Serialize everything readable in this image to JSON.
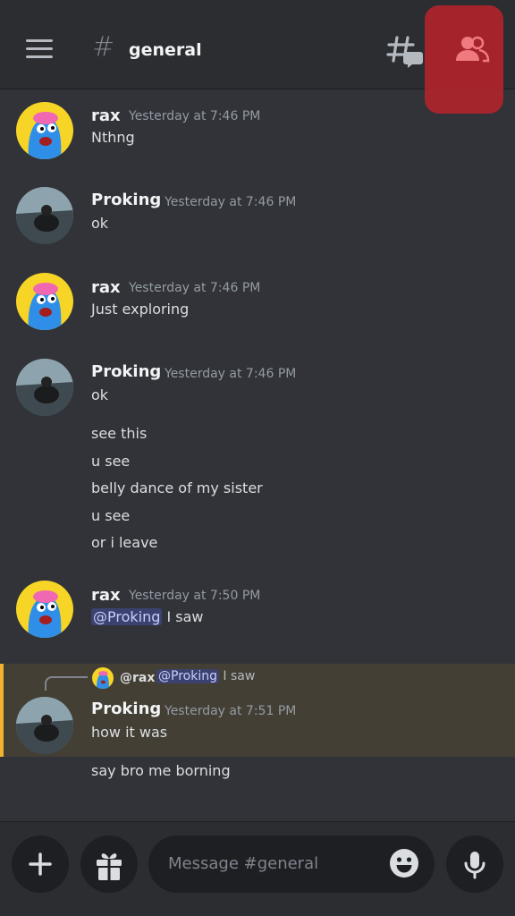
{
  "header": {
    "hash": "#",
    "channel_name": "general"
  },
  "messages": [
    {
      "author": "rax",
      "time": "Yesterday at 7:46 PM",
      "lines": [
        "Nthng"
      ]
    },
    {
      "author": "Proking",
      "time": "Yesterday at 7:46 PM",
      "lines": [
        "ok"
      ]
    },
    {
      "author": "rax",
      "time": "Yesterday at 7:46 PM",
      "lines": [
        "Just exploring"
      ]
    },
    {
      "author": "Proking",
      "time": "Yesterday at 7:46 PM",
      "lines": [
        "ok",
        "see this",
        "u see",
        "belly dance of my sister",
        "u see",
        "or i leave"
      ]
    },
    {
      "author": "rax",
      "time": "Yesterday at 7:50 PM",
      "mention": "@Proking",
      "lines": [
        "I saw"
      ]
    },
    {
      "author": "Proking",
      "time": "Yesterday at 7:51 PM",
      "lines": [
        "how it was",
        "say bro me borning"
      ]
    }
  ],
  "reply_preview": {
    "author": "@rax",
    "mention": "@Proking",
    "text": "I saw"
  },
  "composer": {
    "placeholder": "Message #general"
  },
  "icons": {
    "menu": "hamburger-icon",
    "threads": "threads-icon",
    "members": "members-icon",
    "add": "plus-icon",
    "gift": "gift-icon",
    "emoji": "emoji-icon",
    "mic": "microphone-icon"
  },
  "colors": {
    "background": "#313338",
    "header": "#2b2d31",
    "highlight": "#b3232c",
    "reply_accent": "#f0b232",
    "mention_bg": "#3c4270"
  }
}
